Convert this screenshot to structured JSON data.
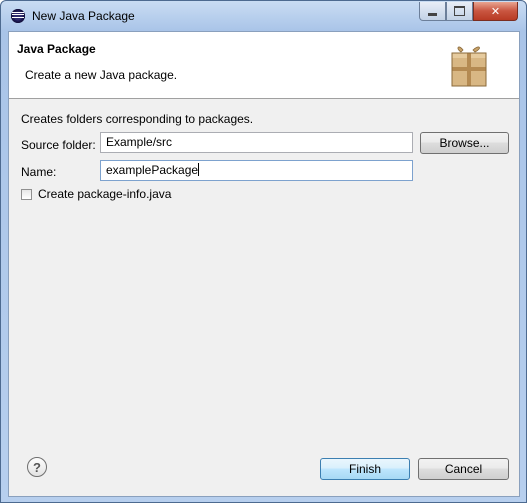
{
  "window": {
    "title": "New Java Package",
    "controls": {
      "minimize": "minimize-icon",
      "maximize": "maximize-icon",
      "close": "✕"
    }
  },
  "banner": {
    "title": "Java Package",
    "description": "Create a new Java package.",
    "icon": "package-icon"
  },
  "form": {
    "description": "Creates folders corresponding to packages.",
    "source_folder": {
      "label": "Source folder:",
      "value": "Example/src"
    },
    "browse_label": "Browse...",
    "name": {
      "label": "Name:",
      "value": "examplePackage"
    },
    "package_info": {
      "label": "Create package-info.java",
      "checked": false
    }
  },
  "footer": {
    "help_glyph": "?",
    "finish_label": "Finish",
    "cancel_label": "Cancel"
  },
  "colors": {
    "title_bar": "#b7cfee",
    "client_bg": "#f0f0f0",
    "close_button": "#c95540",
    "finish_accent": "#3c7fb1"
  }
}
